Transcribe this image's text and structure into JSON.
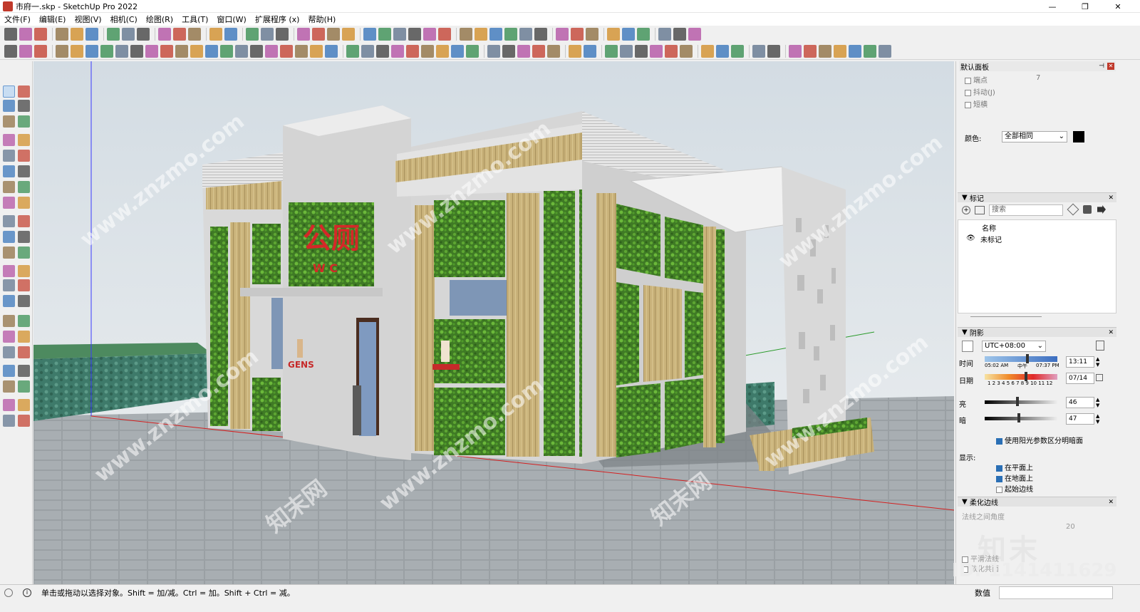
{
  "window": {
    "title": "市府一.skp - SketchUp Pro 2022",
    "minimize": "—",
    "maximize": "❐",
    "close": "✕"
  },
  "menu": [
    "文件(F)",
    "编辑(E)",
    "视图(V)",
    "相机(C)",
    "绘图(R)",
    "工具(T)",
    "窗口(W)",
    "扩展程序 (x)",
    "帮助(H)"
  ],
  "scene": {
    "sign_main": "公厕",
    "sign_sub": "W C",
    "sign_gens": "GENS"
  },
  "watermarks": {
    "site": "www.znzmo.com",
    "brand": "知末网",
    "logo": "知末",
    "id": "ID: 1141411629"
  },
  "panel": {
    "tray_title": "默认面板",
    "styles": {
      "endpoints": "端点",
      "endpoints_value": "7",
      "jitter": "抖动(J)",
      "dashes": "短横",
      "color_label": "颜色:",
      "color_value": "全部相同",
      "color_swatch": "#000000"
    },
    "tags": {
      "title": "标记",
      "search_placeholder": "搜索",
      "name_header": "名称",
      "untagged": "未标记"
    },
    "shadows": {
      "title": "阴影",
      "timezone": "UTC+08:00",
      "time_label": "时间",
      "time_start": "05:02 AM",
      "time_mid": "中午",
      "time_end": "07:37 PM",
      "time_value": "13:11",
      "date_label": "日期",
      "months": "1 2 3 4 5 6 7 8 9 10 11 12",
      "date_value": "07/14",
      "light_label": "亮",
      "light_value": "46",
      "dark_label": "暗",
      "dark_value": "47",
      "use_sun": "使用阳光参数区分明暗面",
      "display_label": "显示:",
      "on_faces": "在平面上",
      "on_ground": "在地面上",
      "from_edges": "起始边线"
    },
    "soften": {
      "title": "柔化边线",
      "normals_angle": "法线之间角度",
      "angle_value": "20",
      "smooth_normals": "平滑法线",
      "soften_coplanar": "软化共面"
    }
  },
  "status": {
    "hint": "单击或拖动以选择对象。Shift = 加/减。Ctrl = 加。Shift + Ctrl = 减。",
    "measure_label": "数值",
    "measure_value": ""
  }
}
